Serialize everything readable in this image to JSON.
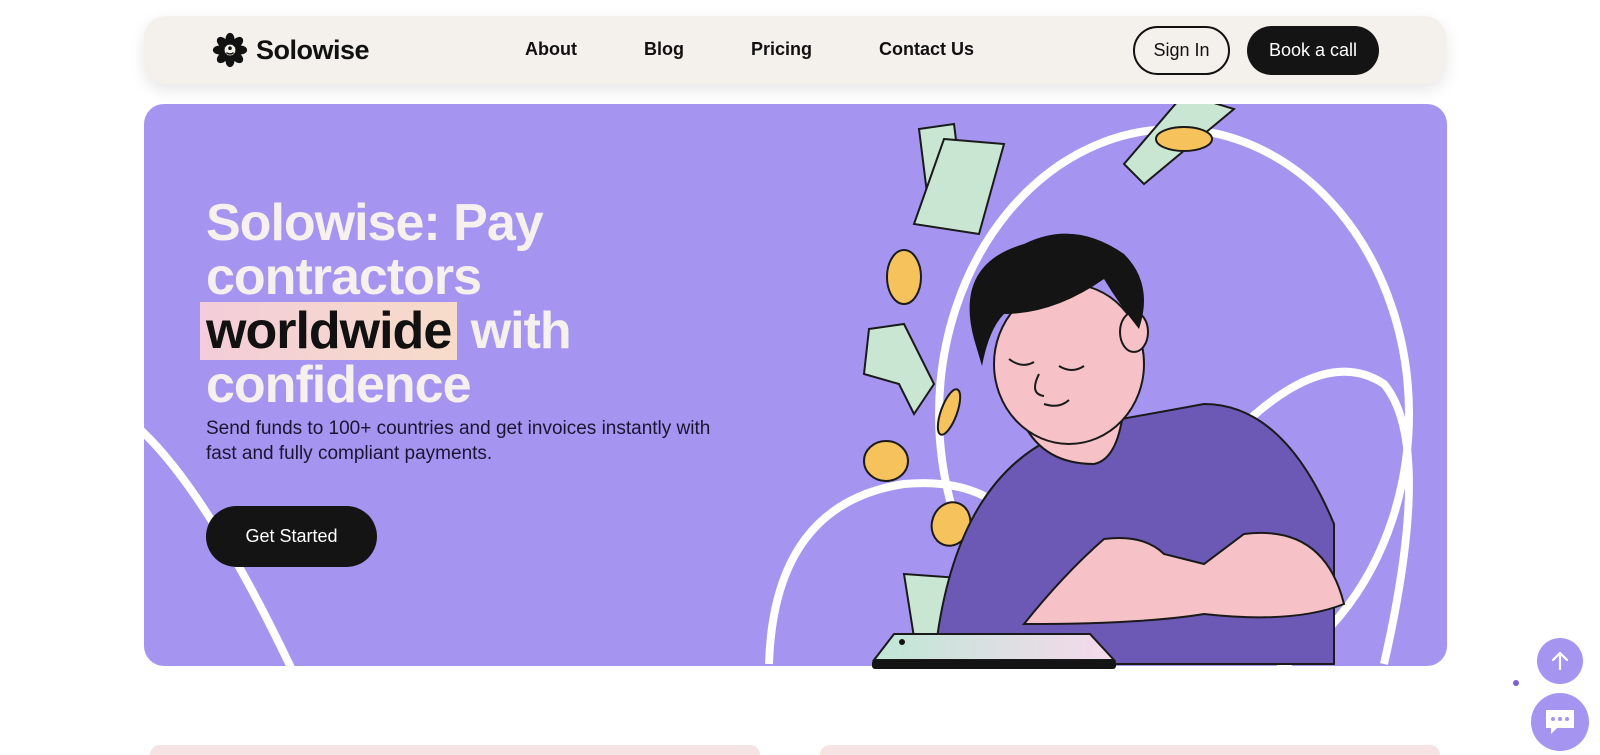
{
  "nav": {
    "brand": "Solowise",
    "links": [
      "About",
      "Blog",
      "Pricing",
      "Contact Us"
    ],
    "sign_in": "Sign In",
    "book_call": "Book a call"
  },
  "hero": {
    "headline_part1": "Solowise: Pay contractors",
    "headline_highlight": "worldwide",
    "headline_part2": "with confidence",
    "subtext": "Send funds to 100+ countries and get invoices instantly with fast and fully compliant payments.",
    "cta": "Get Started"
  },
  "colors": {
    "hero_bg": "#a595f1",
    "nav_bg": "#f4f0ec",
    "dark_button": "#141414",
    "highlight": "#f3cdd9"
  },
  "icons": [
    "flower-logo-icon",
    "arrow-up-icon",
    "chat-icon"
  ]
}
